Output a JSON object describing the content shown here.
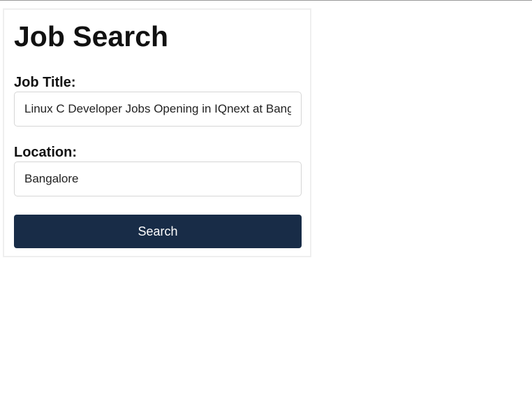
{
  "page": {
    "title": "Job Search"
  },
  "form": {
    "job_title_label": "Job Title:",
    "job_title_value": "Linux C Developer Jobs Opening in IQnext at Bangalore",
    "location_label": "Location:",
    "location_value": "Bangalore",
    "search_label": "Search"
  },
  "colors": {
    "button_bg": "#182c47",
    "button_text": "#ffffff"
  }
}
